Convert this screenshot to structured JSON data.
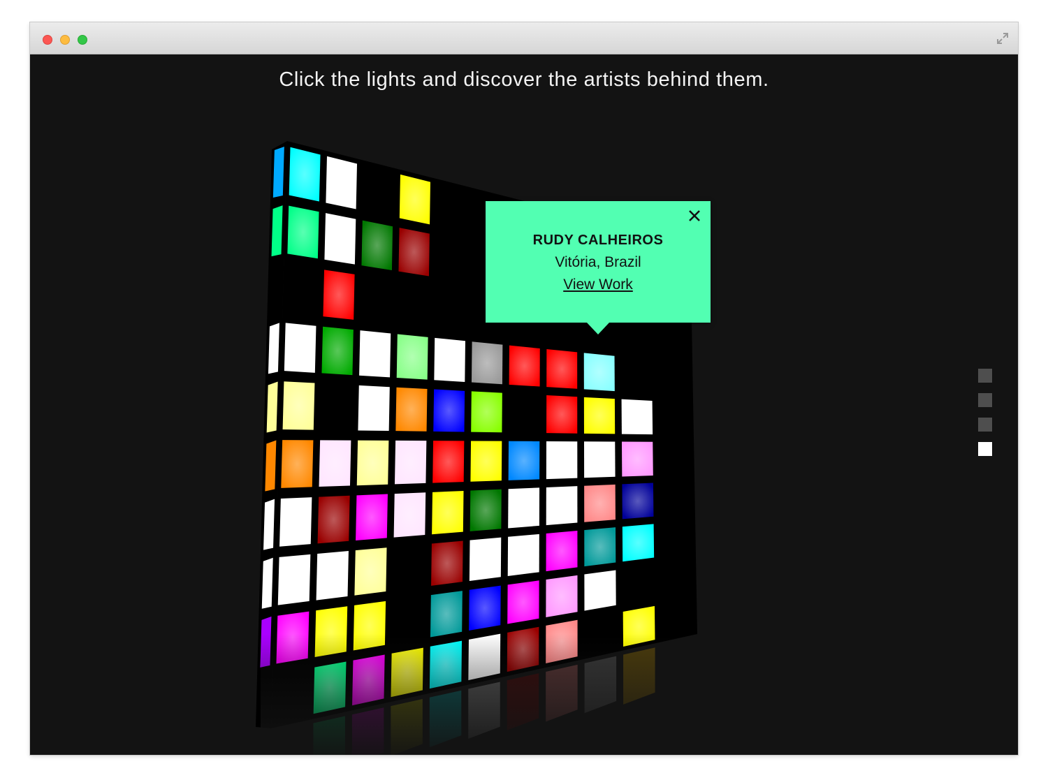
{
  "headline": "Click the lights and discover the artists behind them.",
  "popup": {
    "artist_name": "RUDY CALHEIROS",
    "location": "Vitória, Brazil",
    "link_label": "View Work",
    "close_icon": "close-icon",
    "background": "#52ffb2"
  },
  "pagination": {
    "count": 4,
    "active_index": 3
  },
  "colors": {
    "W": "#ffffff",
    "C": "#00ffff",
    "LC": "#88ffff",
    "LG": "#00ff88",
    "GR": "#00aa00",
    "DG": "#007700",
    "Y": "#ffff00",
    "LY": "#ffff99",
    "R": "#ff0000",
    "DR": "#990000",
    "M": "#ff00ff",
    "PK": "#ff99ff",
    "LP": "#ffe6ff",
    "O": "#ff8800",
    "B": "#0000ff",
    "DB": "#000099",
    "MB": "#0088ff",
    "LI": "#88ff00",
    "LGR": "#88ff88",
    "GY": "#999999",
    "SA": "#ff8888",
    "TE": "#009999",
    "PU": "#aa00ff",
    "SB": "#00aaff",
    "DY": "#ddaa00"
  },
  "light_wall": {
    "rows": [
      [
        "C",
        "W",
        "",
        "Y",
        "",
        "",
        "",
        "",
        "",
        "",
        ""
      ],
      [
        "LG",
        "W",
        "DG",
        "DR",
        "",
        "",
        "",
        "",
        "",
        "",
        ""
      ],
      [
        "",
        "R",
        "",
        "",
        "",
        "",
        "",
        "",
        "",
        "",
        ""
      ],
      [
        "W",
        "GR",
        "W",
        "LGR",
        "W",
        "GY",
        "R",
        "R",
        "LC",
        "",
        ""
      ],
      [
        "LY",
        "",
        "W",
        "O",
        "B",
        "LI",
        "",
        "R",
        "Y",
        "W",
        ""
      ],
      [
        "O",
        "LP",
        "LY",
        "LP",
        "R",
        "Y",
        "MB",
        "W",
        "W",
        "PK",
        ""
      ],
      [
        "W",
        "DR",
        "M",
        "LP",
        "Y",
        "DG",
        "W",
        "W",
        "SA",
        "DB",
        ""
      ],
      [
        "W",
        "W",
        "LY",
        "",
        "DR",
        "W",
        "W",
        "M",
        "TE",
        "C",
        ""
      ],
      [
        "M",
        "Y",
        "Y",
        "",
        "TE",
        "B",
        "M",
        "PK",
        "W",
        "",
        ""
      ],
      [
        "",
        "LG",
        "M",
        "Y",
        "C",
        "W",
        "DR",
        "SA",
        "",
        "Y",
        ""
      ]
    ],
    "side_strip": [
      "SB",
      "LG",
      "",
      "W",
      "LY",
      "O",
      "W",
      "W",
      "PU",
      ""
    ],
    "reflection": [
      "",
      "LG",
      "M",
      "Y",
      "C",
      "W",
      "DR",
      "SA",
      "GY",
      "DY",
      ""
    ]
  }
}
